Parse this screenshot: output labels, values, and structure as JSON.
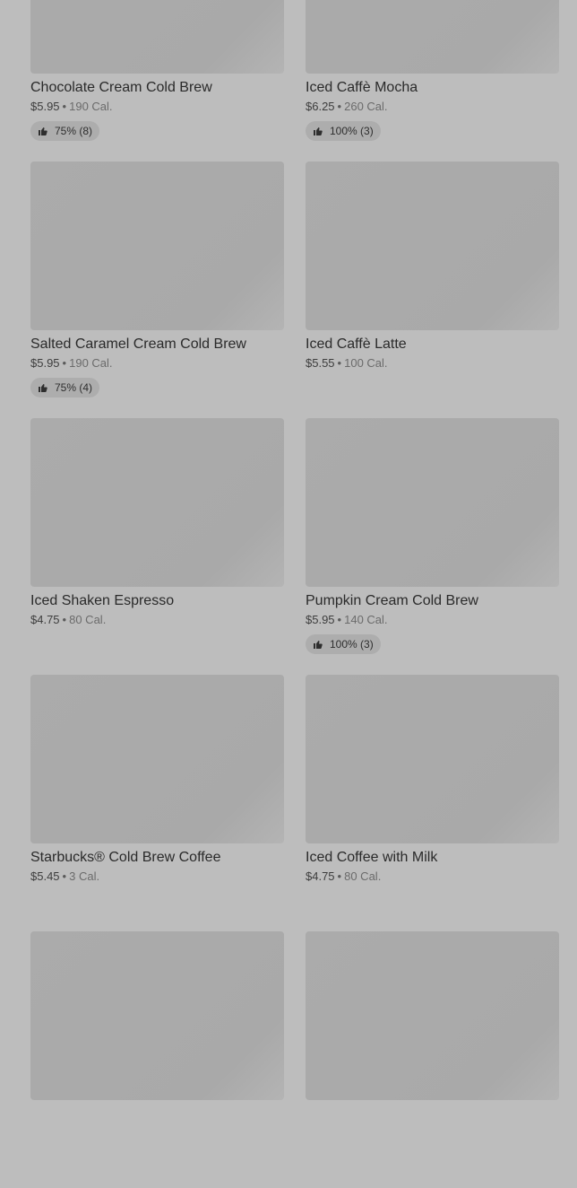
{
  "items": [
    {
      "name": "Chocolate Cream Cold Brew",
      "price": "$5.95",
      "calories": "190 Cal.",
      "rating": "75% (8)"
    },
    {
      "name": "Iced Caffè Mocha",
      "price": "$6.25",
      "calories": "260 Cal.",
      "rating": "100% (3)"
    },
    {
      "name": "Salted Caramel Cream Cold Brew",
      "price": "$5.95",
      "calories": "190 Cal.",
      "rating": "75% (4)"
    },
    {
      "name": "Iced Caffè Latte",
      "price": "$5.55",
      "calories": "100 Cal.",
      "rating": null
    },
    {
      "name": "Iced Shaken Espresso",
      "price": "$4.75",
      "calories": "80 Cal.",
      "rating": null
    },
    {
      "name": "Pumpkin Cream Cold Brew",
      "price": "$5.95",
      "calories": "140 Cal.",
      "rating": "100% (3)"
    },
    {
      "name": "Starbucks® Cold Brew Coffee",
      "price": "$5.45",
      "calories": "3 Cal.",
      "rating": null
    },
    {
      "name": "Iced Coffee with Milk",
      "price": "$4.75",
      "calories": "80 Cal.",
      "rating": null
    },
    {
      "name": "",
      "price": "",
      "calories": "",
      "rating": null
    },
    {
      "name": "",
      "price": "",
      "calories": "",
      "rating": null
    }
  ],
  "separator": "•",
  "icons": {
    "rating": "thumbs-up-icon"
  },
  "colors": {
    "overlay": "#bdbdbd",
    "image_placeholder": "#ababab",
    "rating_pill": "#adadad"
  }
}
